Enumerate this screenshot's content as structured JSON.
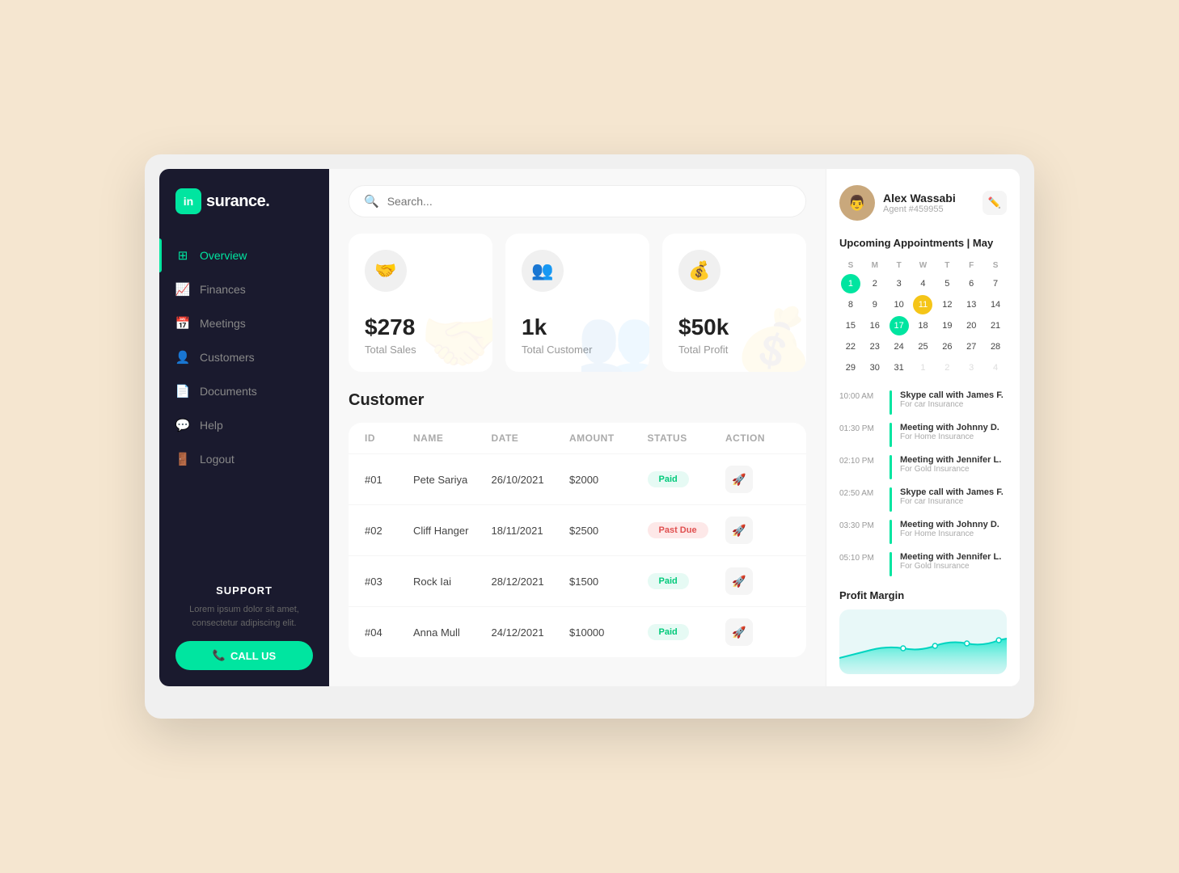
{
  "app": {
    "logo_icon": "in",
    "logo_name": "surance.",
    "search_placeholder": "Search..."
  },
  "sidebar": {
    "nav_items": [
      {
        "id": "overview",
        "label": "Overview",
        "icon": "⊞",
        "active": true
      },
      {
        "id": "finances",
        "label": "Finances",
        "icon": "📊",
        "active": false
      },
      {
        "id": "meetings",
        "label": "Meetings",
        "icon": "📅",
        "active": false
      },
      {
        "id": "customers",
        "label": "Customers",
        "icon": "👤",
        "active": false
      },
      {
        "id": "documents",
        "label": "Documents",
        "icon": "📄",
        "active": false
      },
      {
        "id": "help",
        "label": "Help",
        "icon": "💬",
        "active": false
      },
      {
        "id": "logout",
        "label": "Logout",
        "icon": "🚪",
        "active": false
      }
    ],
    "support": {
      "title": "SUPPORT",
      "text": "Lorem ipsum dolor sit amet, consectetur adipiscing elit.",
      "button_label": "CALL US"
    }
  },
  "stats": [
    {
      "id": "total-sales",
      "icon": "🤝",
      "value": "$278",
      "label": "Total Sales"
    },
    {
      "id": "total-customer",
      "icon": "👥",
      "value": "1k",
      "label": "Total Customer"
    },
    {
      "id": "total-profit",
      "icon": "💰",
      "value": "$50k",
      "label": "Total Profit"
    }
  ],
  "customer_section": {
    "title": "Customer",
    "table_headers": [
      "ID",
      "NAME",
      "DATE",
      "AMOUNT",
      "STATUS",
      "ACTION"
    ],
    "rows": [
      {
        "id": "#01",
        "name": "Pete Sariya",
        "date": "26/10/2021",
        "amount": "$2000",
        "status": "Paid",
        "status_type": "paid"
      },
      {
        "id": "#02",
        "name": "Cliff Hanger",
        "date": "18/11/2021",
        "amount": "$2500",
        "status": "Past Due",
        "status_type": "past-due"
      },
      {
        "id": "#03",
        "name": "Rock Iai",
        "date": "28/12/2021",
        "amount": "$1500",
        "status": "Paid",
        "status_type": "paid"
      },
      {
        "id": "#04",
        "name": "Anna Mull",
        "date": "24/12/2021",
        "amount": "$10000",
        "status": "Paid",
        "status_type": "paid"
      }
    ]
  },
  "right_panel": {
    "user": {
      "name": "Alex Wassabi",
      "agent_id": "Agent #459955"
    },
    "calendar": {
      "title": "Upcoming Appointments | May",
      "weekdays": [
        "S",
        "M",
        "T",
        "W",
        "T",
        "F",
        "S"
      ],
      "weeks": [
        [
          "1",
          "2",
          "3",
          "4",
          "5",
          "6",
          "7"
        ],
        [
          "8",
          "9",
          "10",
          "11",
          "12",
          "13",
          "14"
        ],
        [
          "15",
          "16",
          "17",
          "18",
          "19",
          "20",
          "21"
        ],
        [
          "22",
          "23",
          "24",
          "25",
          "26",
          "27",
          "28"
        ],
        [
          "29",
          "30",
          "31",
          "1",
          "2",
          "3",
          "4"
        ]
      ],
      "today_green": "1",
      "today_yellow": "11",
      "today_red": "17"
    },
    "appointments": [
      {
        "time": "10:00 AM",
        "title": "Skype call with James F.",
        "sub": "For car Insurance"
      },
      {
        "time": "01:30 PM",
        "title": "Meeting with Johnny D.",
        "sub": "For Home Insurance"
      },
      {
        "time": "02:10 PM",
        "title": "Meeting with Jennifer L.",
        "sub": "For Gold Insurance"
      },
      {
        "time": "02:50 AM",
        "title": "Skype call with James F.",
        "sub": "For car Insurance"
      },
      {
        "time": "03:30 PM",
        "title": "Meeting with Johnny D.",
        "sub": "For Home Insurance"
      },
      {
        "time": "05:10 PM",
        "title": "Meeting with Jennifer L.",
        "sub": "For Gold Insurance"
      }
    ],
    "profit_margin": {
      "title": "Profit Margin"
    }
  }
}
